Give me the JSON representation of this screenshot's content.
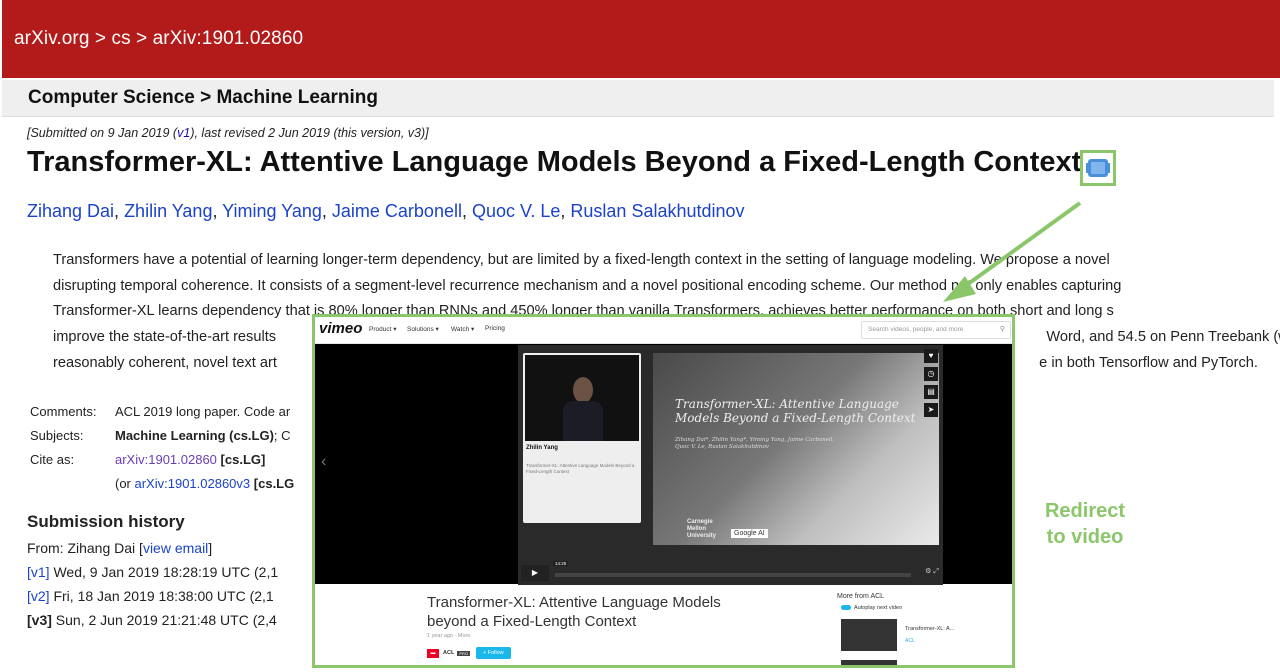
{
  "header": {
    "breadcrumb": "arXiv.org > cs > arXiv:1901.02860",
    "category": "Computer Science > Machine Learning"
  },
  "paper": {
    "submitted_prefix": "[Submitted on 9 Jan 2019 (",
    "v1_link": "v1",
    "submitted_suffix": "), last revised 2 Jun 2019 (this version, v3)]",
    "title": "Transformer-XL: Attentive Language Models Beyond a Fixed-Length Context",
    "authors": [
      "Zihang Dai",
      "Zhilin Yang",
      "Yiming Yang",
      "Jaime Carbonell",
      "Quoc V. Le",
      "Ruslan Salakhutdinov"
    ],
    "abstract_lines": [
      "Transformers have a potential of learning longer-term dependency, but are limited by a fixed-length context in the setting of language modeling. We propose a novel",
      "disrupting temporal coherence. It consists of a segment-level recurrence mechanism and a novel positional encoding scheme. Our method not only enables capturing",
      "Transformer-XL learns dependency that is 80% longer than RNNs and 450% longer than vanilla Transformers, achieves better performance on both short and long s",
      "improve the state-of-the-art results                                                                                                                                                                                              Word, and 54.5 on Penn Treebank (w",
      "reasonably coherent, novel text art                                                                                                                                                                                            e in both Tensorflow and PyTorch."
    ]
  },
  "metadata": {
    "comments_label": "Comments:",
    "comments_value": "ACL 2019 long paper. Code ar",
    "subjects_label": "Subjects:",
    "subjects_value": "Machine Learning (cs.LG)",
    "subjects_rest": "; C",
    "cite_label": "Cite as:",
    "cite_link": "arXiv:1901.02860",
    "cite_tag": "[cs.LG]",
    "cite_or": "(or ",
    "cite_v3_link": "arXiv:1901.02860v3",
    "cite_v3_tag": "[cs.LG"
  },
  "history": {
    "title": "Submission history",
    "from_prefix": "From: Zihang Dai [",
    "view_email": "view email",
    "from_suffix": "]",
    "versions": [
      {
        "tag": "[v1]",
        "text": " Wed, 9 Jan 2019 18:28:19 UTC (2,1"
      },
      {
        "tag": "[v2]",
        "text": " Fri, 18 Jan 2019 18:38:00 UTC (2,1"
      },
      {
        "tag": "[v3]",
        "text": " Sun, 2 Jun 2019 21:21:48 UTC (2,4"
      }
    ]
  },
  "annotation": {
    "redirect_label_line1": "Redirect",
    "redirect_label_line2": "to video",
    "color": "#8bc76a"
  },
  "vimeo": {
    "logo": "vimeo",
    "menu": [
      "Product ▾",
      "Solutions ▾",
      "Watch ▾",
      "Pricing"
    ],
    "search_placeholder": "Search videos, people, and more",
    "speaker_name": "Zhilin Yang",
    "speaker_sub": "Transformer-XL: Attentive Language Models Beyond a Fixed-Length Context",
    "slide_title_line1": "Transformer-XL: Attentive Language",
    "slide_title_line2": "Models Beyond a Fixed-Length Context",
    "slide_authors_line1": "Zihang Dai*, Zhilin Yang*, Yiming Yang, Jaime Carbonell,",
    "slide_authors_line2": "Quoc V. Le, Ruslan Salakhutdinov",
    "slide_cmu_line1": "Carnegie",
    "slide_cmu_line2": "Mellon",
    "slide_cmu_line3": "University",
    "slide_google": "Google AI",
    "time_label": "14:25",
    "video_title": "Transformer-XL: Attentive Language Models beyond a Fixed-Length Context",
    "video_meta": "1 year ago · More",
    "channel": "ACL",
    "channel_badge": "PRO",
    "follow_label": "+ Follow",
    "more_from": "More from ACL",
    "autoplay_label": "Autoplay next video",
    "next_title": "Transformer-XL: A...",
    "next_channel": "ACL",
    "accent": "#1ab7ea"
  }
}
